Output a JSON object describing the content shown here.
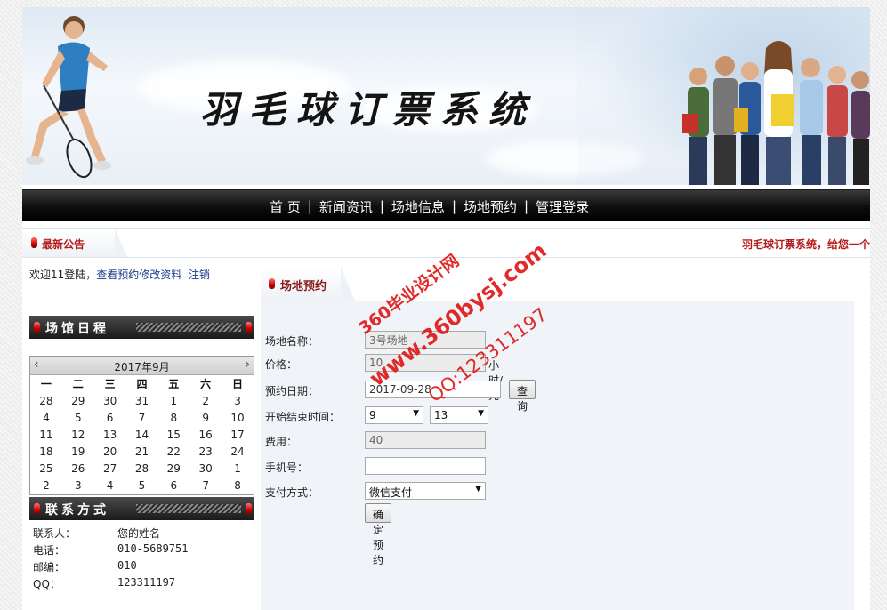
{
  "banner": {
    "title": "羽毛球订票系统"
  },
  "nav": {
    "items": [
      "首 页",
      "新闻资讯",
      "场地信息",
      "场地预约",
      "管理登录"
    ]
  },
  "notice": {
    "title": "最新公告",
    "text": "羽毛球订票系统，给您一个"
  },
  "welcome": {
    "text": "欢迎11登陆，",
    "links": [
      "查看预约修改资料",
      "注销"
    ]
  },
  "sidebar": {
    "schedule_title": "场馆日程",
    "contact_title": "联系方式",
    "contact": [
      {
        "label": "联系人：",
        "value": "您的姓名"
      },
      {
        "label": "电话：",
        "value": "010-5689751"
      },
      {
        "label": "邮编：",
        "value": "010"
      },
      {
        "label": "QQ：",
        "value": "123311197"
      }
    ]
  },
  "calendar": {
    "title": "2017年9月",
    "prev": "‹",
    "next": "›",
    "weekdays": [
      "一",
      "二",
      "三",
      "四",
      "五",
      "六",
      "日"
    ],
    "weeks": [
      [
        "28",
        "29",
        "30",
        "31",
        "1",
        "2",
        "3"
      ],
      [
        "4",
        "5",
        "6",
        "7",
        "8",
        "9",
        "10"
      ],
      [
        "11",
        "12",
        "13",
        "14",
        "15",
        "16",
        "17"
      ],
      [
        "18",
        "19",
        "20",
        "21",
        "22",
        "23",
        "24"
      ],
      [
        "25",
        "26",
        "27",
        "28",
        "29",
        "30",
        "1"
      ],
      [
        "2",
        "3",
        "4",
        "5",
        "6",
        "7",
        "8"
      ]
    ]
  },
  "panel": {
    "title": "场地预约"
  },
  "form": {
    "venue_label": "场地名称：",
    "venue_value": "3号场地",
    "price_label": "价格：",
    "price_value": "10",
    "price_unit": "小时/元",
    "date_label": "预约日期：",
    "date_value": "2017-09-28",
    "query_button": "查询",
    "time_label": "开始结束时间：",
    "start_value": "9",
    "end_value": "13",
    "fee_label": "费用：",
    "fee_value": "40",
    "phone_label": "手机号：",
    "phone_value": "",
    "pay_label": "支付方式：",
    "pay_value": "微信支付",
    "submit_button": "确定预约"
  },
  "watermark": {
    "line1": "360毕业设计网",
    "line2": "www.360bysj.com",
    "line3": "QQ:123311197"
  }
}
